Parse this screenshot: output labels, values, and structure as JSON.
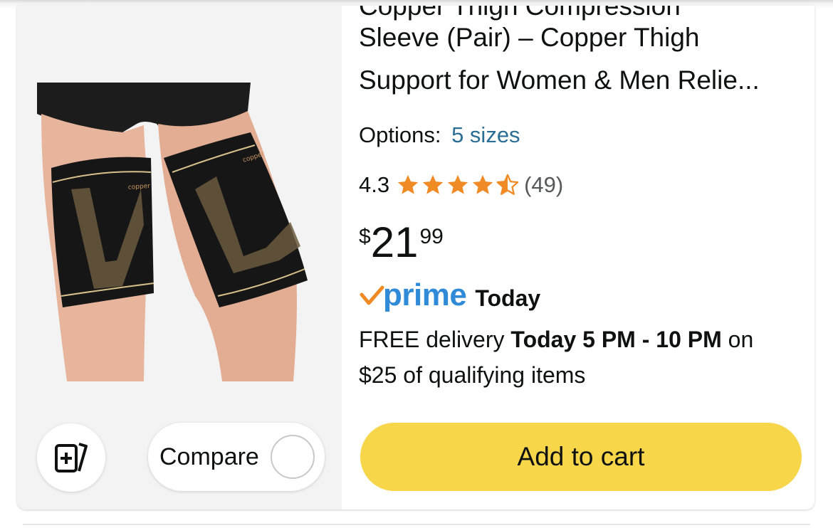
{
  "product": {
    "title_cut": "Copper Thigh Compression",
    "title_line1": "Sleeve (Pair) – Copper Thigh",
    "title_line2": "Support for Women & Men Relie...",
    "options_label": "Options:",
    "options_value": "5 sizes",
    "rating_value": "4.3",
    "rating_fraction": 0.86,
    "rating_count": "(49)",
    "price_symbol": "$",
    "price_whole": "21",
    "price_fraction": "99",
    "prime_word": "prime",
    "prime_today": "Today",
    "delivery_prefix": "FREE delivery ",
    "delivery_window": "Today 5 PM - 10 PM",
    "delivery_suffix": " on",
    "delivery_line2": "$25 of qualifying items",
    "image_brand_text": "copper"
  },
  "actions": {
    "compare_label": "Compare",
    "add_to_cart_label": "Add to cart",
    "cart_button_color": "#f7d64a"
  },
  "colors": {
    "star": "#f08a24",
    "link": "#2a6e95",
    "prime_blue": "#2f8ad8",
    "prime_check": "#f08a24"
  },
  "icons": {
    "add_to_list": "add-to-list-icon",
    "star": "star-icon",
    "prime_check": "prime-check-icon"
  }
}
